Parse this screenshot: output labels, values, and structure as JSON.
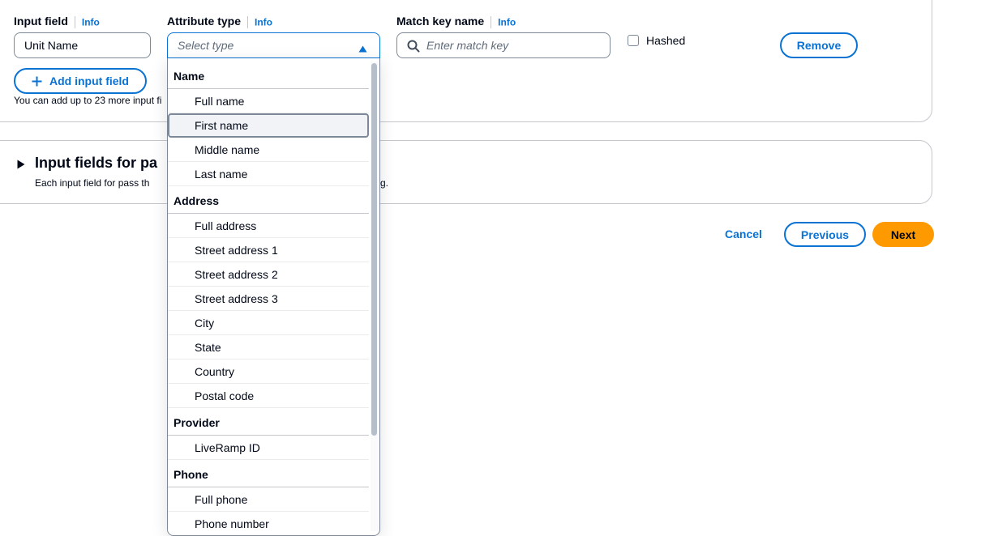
{
  "input_field": {
    "label": "Input field",
    "info": "Info",
    "value": "Unit Name",
    "add_button": "Add input field",
    "add_help": "You can add up to 23 more input fi"
  },
  "attribute_type": {
    "label": "Attribute type",
    "info": "Info",
    "placeholder": "Select type"
  },
  "match_key": {
    "label": "Match key name",
    "info": "Info",
    "placeholder": "Enter match key"
  },
  "hashed_label": "Hashed",
  "remove_button": "Remove",
  "section": {
    "title": "Input fields for pa",
    "desc_left": "Each input field for pass th",
    "desc_right": "g."
  },
  "footer": {
    "cancel": "Cancel",
    "previous": "Previous",
    "next": "Next"
  },
  "dropdown": {
    "groups": [
      {
        "label": "Name",
        "options": [
          "Full name",
          "First name",
          "Middle name",
          "Last name"
        ]
      },
      {
        "label": "Address",
        "options": [
          "Full address",
          "Street address 1",
          "Street address 2",
          "Street address 3",
          "City",
          "State",
          "Country",
          "Postal code"
        ]
      },
      {
        "label": "Provider",
        "options": [
          "LiveRamp ID"
        ]
      },
      {
        "label": "Phone",
        "options": [
          "Full phone",
          "Phone number"
        ]
      }
    ],
    "highlighted": "First name"
  },
  "colors": {
    "accent": "#0972d3",
    "primary_button": "#ff9900",
    "border": "#7d8998"
  },
  "icons": [
    "plus-icon",
    "caret-up-icon",
    "search-icon",
    "caret-right-icon"
  ]
}
